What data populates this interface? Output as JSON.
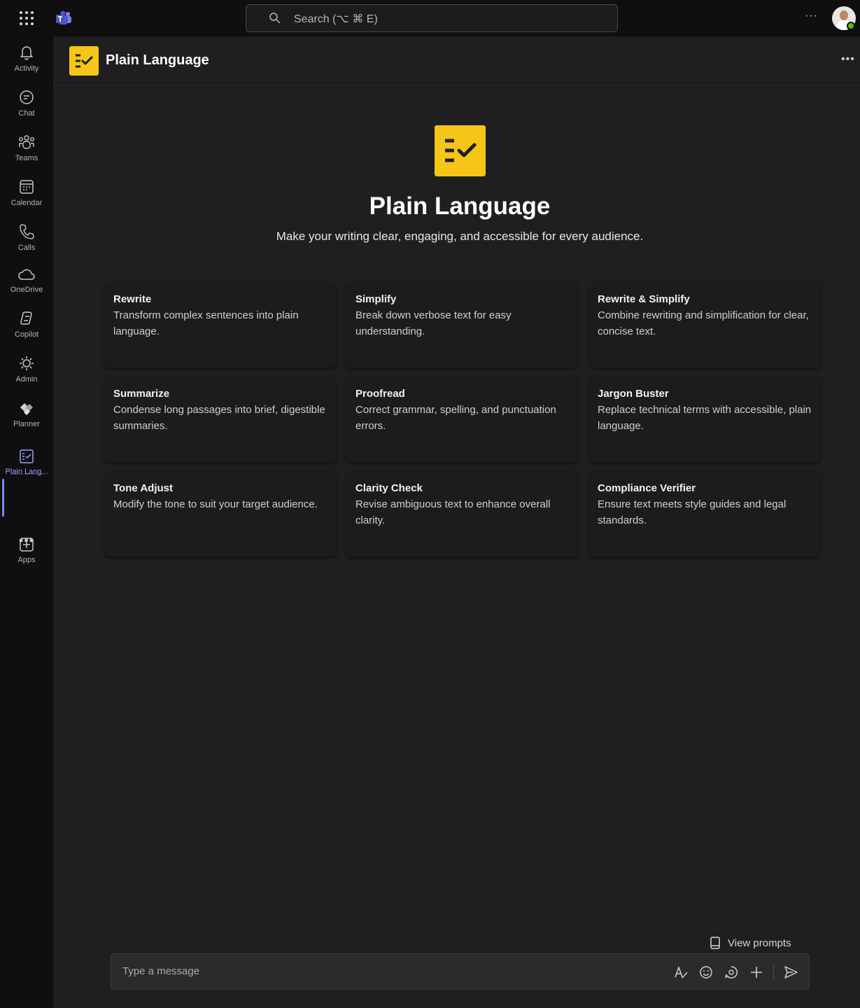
{
  "topbar": {
    "search_placeholder": "Search (⌥ ⌘ E)",
    "more": "···"
  },
  "rail": {
    "items": [
      {
        "label": "Activity",
        "icon": "bell-icon"
      },
      {
        "label": "Chat",
        "icon": "chat-icon"
      },
      {
        "label": "Teams",
        "icon": "teams-icon"
      },
      {
        "label": "Calendar",
        "icon": "calendar-icon"
      },
      {
        "label": "Calls",
        "icon": "phone-icon"
      },
      {
        "label": "OneDrive",
        "icon": "cloud-icon"
      },
      {
        "label": "Copilot",
        "icon": "copilot-icon"
      },
      {
        "label": "Admin",
        "icon": "admin-icon"
      },
      {
        "label": "Planner",
        "icon": "planner-icon"
      },
      {
        "label": "Plain Lang...",
        "icon": "plain-language-icon",
        "active": true
      },
      {
        "label": "Apps",
        "icon": "add-apps-icon"
      }
    ],
    "more": "•••",
    "active_color": "#7f85f5"
  },
  "app": {
    "title": "Plain Language",
    "more": "•••",
    "accent_color": "#f5c518"
  },
  "hero": {
    "title": "Plain Language",
    "subtitle": "Make your writing clear, engaging, and accessible for every audience."
  },
  "cards": [
    {
      "title": "Rewrite",
      "desc": "Transform complex sentences into plain language."
    },
    {
      "title": "Simplify",
      "desc": "Break down verbose text for easy understanding."
    },
    {
      "title": "Rewrite & Simplify",
      "desc": "Combine rewriting and simplification for clear, concise text."
    },
    {
      "title": "Summarize",
      "desc": "Condense long passages into brief, digestible summaries."
    },
    {
      "title": "Proofread",
      "desc": "Correct grammar, spelling, and punctuation errors."
    },
    {
      "title": "Jargon Buster",
      "desc": "Replace technical terms with accessible, plain language."
    },
    {
      "title": "Tone Adjust",
      "desc": "Modify the tone to suit your target audience."
    },
    {
      "title": "Clarity Check",
      "desc": "Revise ambiguous text to enhance overall clarity."
    },
    {
      "title": "Compliance Verifier",
      "desc": "Ensure text meets style guides and legal standards."
    }
  ],
  "footer": {
    "view_prompts": "View prompts",
    "composer_placeholder": "Type a message"
  }
}
